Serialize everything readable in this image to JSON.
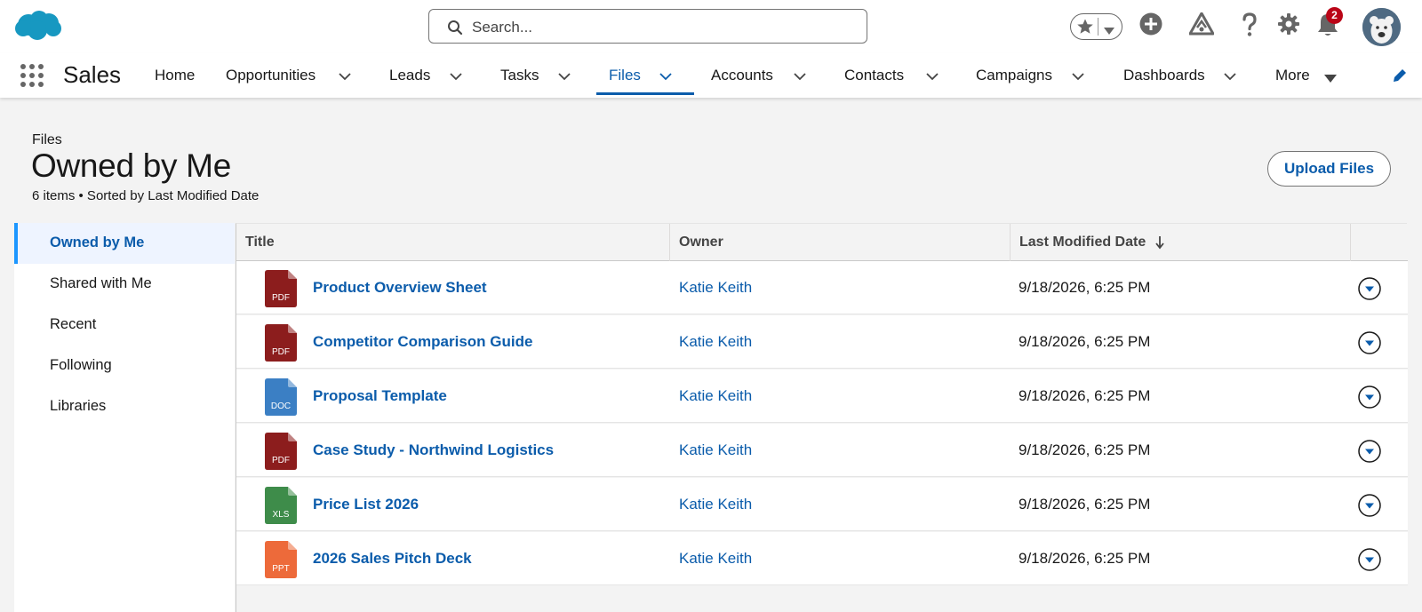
{
  "header": {
    "search_placeholder": "Search...",
    "notification_count": "2"
  },
  "nav": {
    "app_name": "Sales",
    "items": [
      {
        "label": "Home",
        "has_menu": false
      },
      {
        "label": "Opportunities",
        "has_menu": true
      },
      {
        "label": "Leads",
        "has_menu": true
      },
      {
        "label": "Tasks",
        "has_menu": true
      },
      {
        "label": "Files",
        "has_menu": true,
        "active": true
      },
      {
        "label": "Accounts",
        "has_menu": true
      },
      {
        "label": "Contacts",
        "has_menu": true
      },
      {
        "label": "Campaigns",
        "has_menu": true
      },
      {
        "label": "Dashboards",
        "has_menu": true
      },
      {
        "label": "More",
        "has_menu": true
      }
    ]
  },
  "page": {
    "breadcrumb": "Files",
    "title": "Owned by Me",
    "subtitle": "6 items • Sorted by Last Modified Date",
    "upload_label": "Upload Files"
  },
  "sidebar": {
    "items": [
      {
        "label": "Owned by Me",
        "active": true
      },
      {
        "label": "Shared with Me"
      },
      {
        "label": "Recent"
      },
      {
        "label": "Following"
      },
      {
        "label": "Libraries"
      }
    ]
  },
  "table": {
    "columns": [
      "Title",
      "Owner",
      "Last Modified Date"
    ],
    "sort_indicator": "descending",
    "rows": [
      {
        "type": "PDF",
        "color": "#8c1d1d",
        "title": "Product Overview Sheet",
        "owner": "Katie Keith",
        "date": "9/18/2026, 6:25 PM"
      },
      {
        "type": "PDF",
        "color": "#8c1d1d",
        "title": "Competitor Comparison Guide",
        "owner": "Katie Keith",
        "date": "9/18/2026, 6:25 PM"
      },
      {
        "type": "DOC",
        "color": "#3b7fc4",
        "title": "Proposal Template",
        "owner": "Katie Keith",
        "date": "9/18/2026, 6:25 PM"
      },
      {
        "type": "PDF",
        "color": "#8c1d1d",
        "title": "Case Study - Northwind Logistics",
        "owner": "Katie Keith",
        "date": "9/18/2026, 6:25 PM"
      },
      {
        "type": "XLS",
        "color": "#3e8c4a",
        "title": "Price List 2026",
        "owner": "Katie Keith",
        "date": "9/18/2026, 6:25 PM"
      },
      {
        "type": "PPT",
        "color": "#ed6a3a",
        "title": "2026 Sales Pitch Deck",
        "owner": "Katie Keith",
        "date": "9/18/2026, 6:25 PM"
      }
    ]
  }
}
